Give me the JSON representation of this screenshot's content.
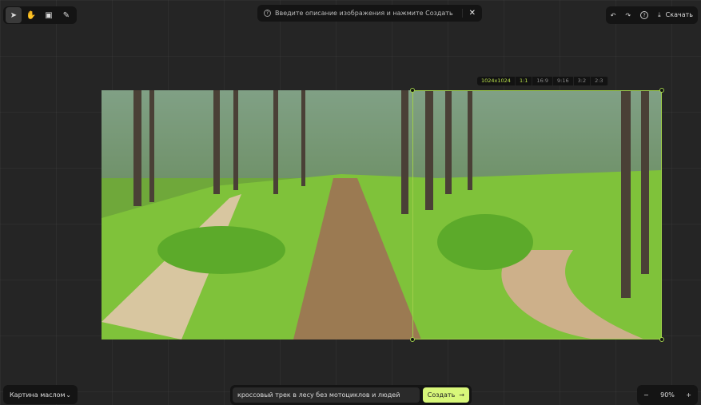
{
  "toolbar": {
    "tools": [
      {
        "name": "select",
        "glyph": "➤"
      },
      {
        "name": "hand",
        "glyph": "✋"
      },
      {
        "name": "image",
        "glyph": "▣"
      },
      {
        "name": "pen",
        "glyph": "✎"
      }
    ]
  },
  "hint": {
    "text": "Введите описание изображения и нажмите Создать",
    "close": "✕"
  },
  "actions": {
    "undo": "↶",
    "redo": "↷",
    "help": "?",
    "download_label": "Скачать"
  },
  "ratios": [
    "1024x1024",
    "1:1",
    "16:9",
    "9:16",
    "3:2",
    "2:3"
  ],
  "selected_ratio": "1:1",
  "style_select": {
    "value": "Картина маслом"
  },
  "prompt": {
    "value": "кроссовый трек в лесу без мотоциклов и людей",
    "submit": "Создать"
  },
  "zoom": {
    "minus": "−",
    "value": "90%",
    "plus": "+"
  },
  "accent": "#d8f77a"
}
